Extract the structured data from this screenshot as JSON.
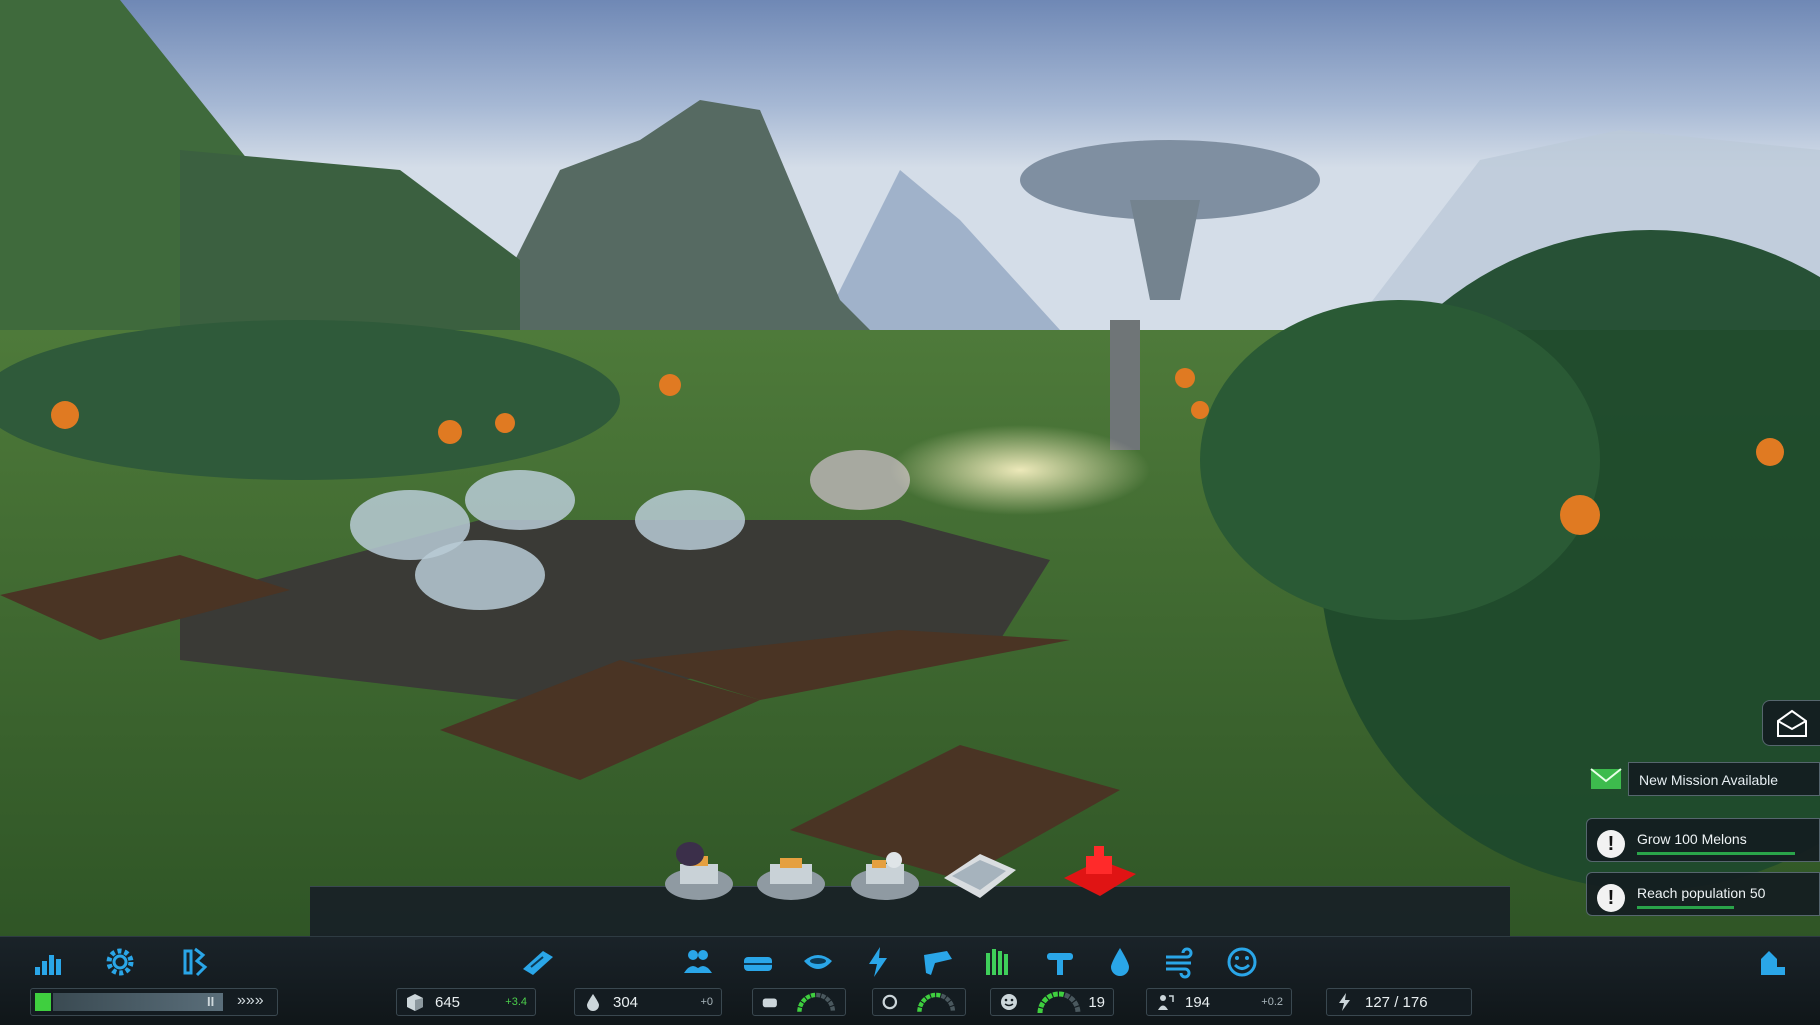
{
  "scene": {
    "description_icon": "alien-planet-colony"
  },
  "mail_button": {
    "icon": "mail-open-icon"
  },
  "notifications": [
    {
      "type": "mail",
      "text": "New Mission Available"
    },
    {
      "type": "alert",
      "text": "Grow 100 Melons",
      "progress": 0.9
    },
    {
      "type": "alert",
      "text": "Reach population 50",
      "progress": 0.55
    }
  ],
  "build_tray": {
    "items": [
      "habitat-module-icon",
      "habitat-module-2-icon",
      "habitat-module-3-icon",
      "greenhouse-icon",
      "red-building-icon"
    ]
  },
  "toolbar": {
    "left": [
      "statistics-icon",
      "settings-gear-icon",
      "research-icon"
    ],
    "center": [
      "road-icon",
      "population-icon",
      "housing-icon",
      "food-bowl-icon",
      "power-icon",
      "mining-icon",
      "agriculture-icon",
      "oxygen-icon",
      "water-icon",
      "wind-icon",
      "happiness-icon"
    ],
    "right": [
      "demolish-icon"
    ]
  },
  "speed": {
    "pause": "II",
    "fast": "»»»"
  },
  "resources": {
    "materials": {
      "value": "645",
      "delta": "+3.4"
    },
    "water": {
      "value": "304",
      "delta": "+0"
    },
    "food_gauge": {
      "level": 0.55
    },
    "oxygen_gauge": {
      "level": 0.6
    },
    "happiness": {
      "level": 0.6,
      "value": "19"
    },
    "population": {
      "value": "194",
      "delta": "+0.2"
    },
    "energy": {
      "value": "127 / 176"
    }
  }
}
